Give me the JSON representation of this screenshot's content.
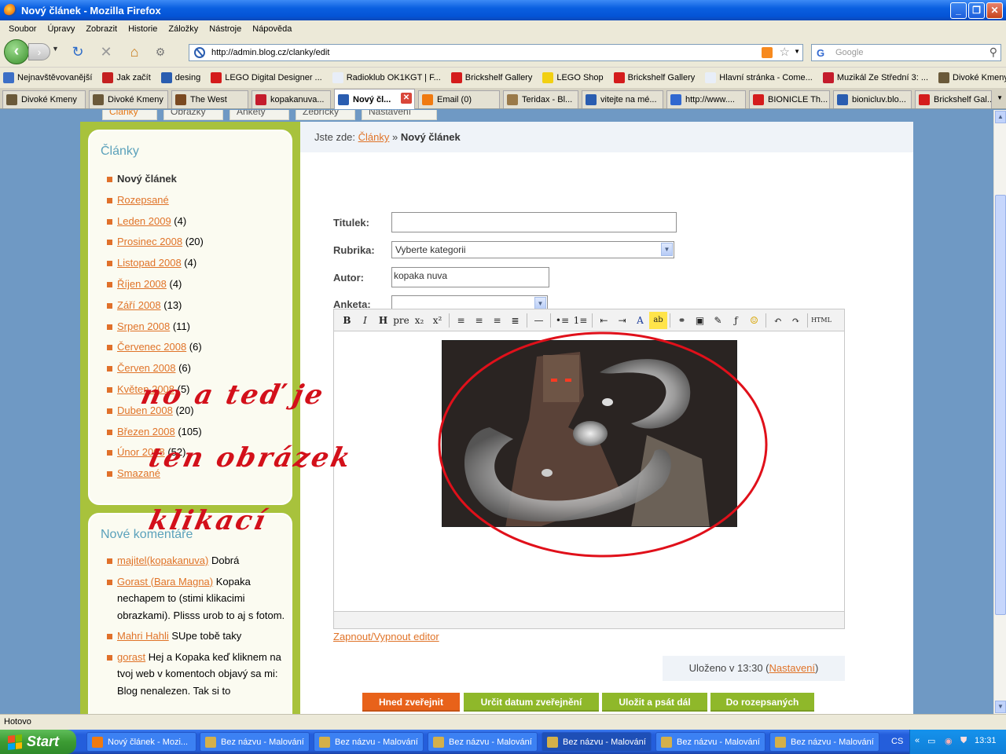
{
  "window": {
    "title": "Nový článek - Mozilla Firefox"
  },
  "menu": [
    "Soubor",
    "Úpravy",
    "Zobrazit",
    "Historie",
    "Záložky",
    "Nástroje",
    "Nápověda"
  ],
  "address": {
    "url": "http://admin.blog.cz/clanky/edit"
  },
  "search": {
    "placeholder": "Google"
  },
  "bookmarks": [
    {
      "label": "Nejnavštěvovanější",
      "color": "#3c6fc6"
    },
    {
      "label": "Jak začít",
      "color": "#c42020"
    },
    {
      "label": "desing",
      "color": "#2a5db0"
    },
    {
      "label": "LEGO Digital Designer ...",
      "color": "#d41c1c"
    },
    {
      "label": "Radioklub OK1KGT | F...",
      "color": "#e8eef8"
    },
    {
      "label": "Brickshelf Gallery",
      "color": "#d41c1c"
    },
    {
      "label": "LEGO Shop",
      "color": "#f2d012"
    },
    {
      "label": "Brickshelf Gallery",
      "color": "#d41c1c"
    },
    {
      "label": "Hlavní stránka - Come...",
      "color": "#e8eef8"
    },
    {
      "label": "Muzikál Ze Střední 3: ...",
      "color": "#c41c2c"
    },
    {
      "label": "Divoké Kmeny - Brows...",
      "color": "#6b5a3a"
    }
  ],
  "tabs": [
    {
      "label": "Divoké Kmeny",
      "color": "#6b5a3a"
    },
    {
      "label": "Divoké Kmeny",
      "color": "#6b5a3a"
    },
    {
      "label": "The West",
      "color": "#7a4a22"
    },
    {
      "label": "kopakanuva...",
      "color": "#c41c2c"
    },
    {
      "label": "Nový čl...",
      "color": "#2a5db0"
    },
    {
      "label": "Email (0)",
      "color": "#f07a10"
    },
    {
      "label": "Teridax - Bl...",
      "color": "#9a7a4a"
    },
    {
      "label": "vitejte na mé...",
      "color": "#2a5db0"
    },
    {
      "label": "http://www....",
      "color": "#3168d0"
    },
    {
      "label": "BIONICLE Th...",
      "color": "#d41c1c"
    },
    {
      "label": "bionicluv.blo...",
      "color": "#2a5db0"
    },
    {
      "label": "Brickshelf Gal...",
      "color": "#d41c1c"
    }
  ],
  "site_nav": [
    "Články",
    "Obrázky",
    "Ankety",
    "Žebříčky",
    "Nastavení"
  ],
  "sidebar": {
    "articles_title": "Články",
    "articles_current": "Nový článek",
    "articles": [
      {
        "label": "Rozepsané",
        "count": ""
      },
      {
        "label": "Leden 2009",
        "count": " (4)"
      },
      {
        "label": "Prosinec 2008",
        "count": " (20)"
      },
      {
        "label": "Listopad 2008",
        "count": " (4)"
      },
      {
        "label": "Říjen 2008",
        "count": " (4)"
      },
      {
        "label": "Září 2008",
        "count": " (13)"
      },
      {
        "label": "Srpen 2008",
        "count": " (11)"
      },
      {
        "label": "Červenec 2008",
        "count": " (6)"
      },
      {
        "label": "Červen 2008",
        "count": " (6)"
      },
      {
        "label": "Květen 2008",
        "count": " (5)"
      },
      {
        "label": "Duben 2008",
        "count": " (20)"
      },
      {
        "label": "Březen 2008",
        "count": " (105)"
      },
      {
        "label": "Únor 2008",
        "count": " (52)"
      },
      {
        "label": "Smazané",
        "count": ""
      }
    ],
    "comments_title": "Nové komentáře",
    "comments": [
      {
        "author": "majitel(kopakanuva)",
        "text": " Dobrá"
      },
      {
        "author": "Gorast (Bara Magna)",
        "text": " Kopaka nechapem to (stimi klikacimi obrazkami). Plisss urob to aj s fotom."
      },
      {
        "author": "Mahri Hahli",
        "text": " SUpe tobě taky"
      },
      {
        "author": "gorast",
        "text": " Hej a Kopaka keď kliknem na tvoj web v komentoch objavý sa mi: Blog nenalezen. Tak si to"
      }
    ]
  },
  "breadcrumb": {
    "prefix": "Jste zde:",
    "link": "Články",
    "sep": "»",
    "current": "Nový článek"
  },
  "form": {
    "title_label": "Titulek:",
    "title_value": "",
    "category_label": "Rubrika:",
    "category_value": "Vyberte kategorii",
    "author_label": "Autor:",
    "author_value": "kopaka nuva",
    "poll_label": "Anketa:",
    "poll_value": ""
  },
  "editor_toolbar": [
    "B",
    "I",
    "H",
    "pre",
    "x₂",
    "x²",
    "|",
    "align-left",
    "align-center",
    "align-right",
    "align-justify",
    "|",
    "—",
    "|",
    "bullet-list",
    "numbered-list",
    "|",
    "outdent",
    "indent",
    "text-color",
    "highlight",
    "|",
    "link",
    "image",
    "edit",
    "flash",
    "smiley",
    "|",
    "undo",
    "redo",
    "|",
    "HTML"
  ],
  "toggle_editor": "Zapnout/Vypnout editor",
  "saved": {
    "prefix": "Uloženo v 13:30 (",
    "link": "Nastavení",
    "suffix": ")"
  },
  "actions": [
    {
      "label": "Hned zveřejnit",
      "color": "#e8621a"
    },
    {
      "label": "Určit datum zveřejnění",
      "color": "#8fb82a"
    },
    {
      "label": "Uložit a psát dál",
      "color": "#8fb82a"
    },
    {
      "label": "Do rozepsaných",
      "color": "#8fb82a"
    }
  ],
  "annotation": [
    "no a teď je",
    "ten obrázek",
    "klikací"
  ],
  "status": "Hotovo",
  "taskbar": {
    "start": "Start",
    "items": [
      {
        "label": "Nový článek - Mozi...",
        "active": false
      },
      {
        "label": "Bez názvu - Malování",
        "active": false
      },
      {
        "label": "Bez názvu - Malování",
        "active": false
      },
      {
        "label": "Bez názvu - Malování",
        "active": false
      },
      {
        "label": "Bez názvu - Malování",
        "active": true
      },
      {
        "label": "Bez názvu - Malování",
        "active": false
      },
      {
        "label": "Bez názvu - Malování",
        "active": false
      }
    ],
    "lang": "CS",
    "clock": "13:31"
  }
}
